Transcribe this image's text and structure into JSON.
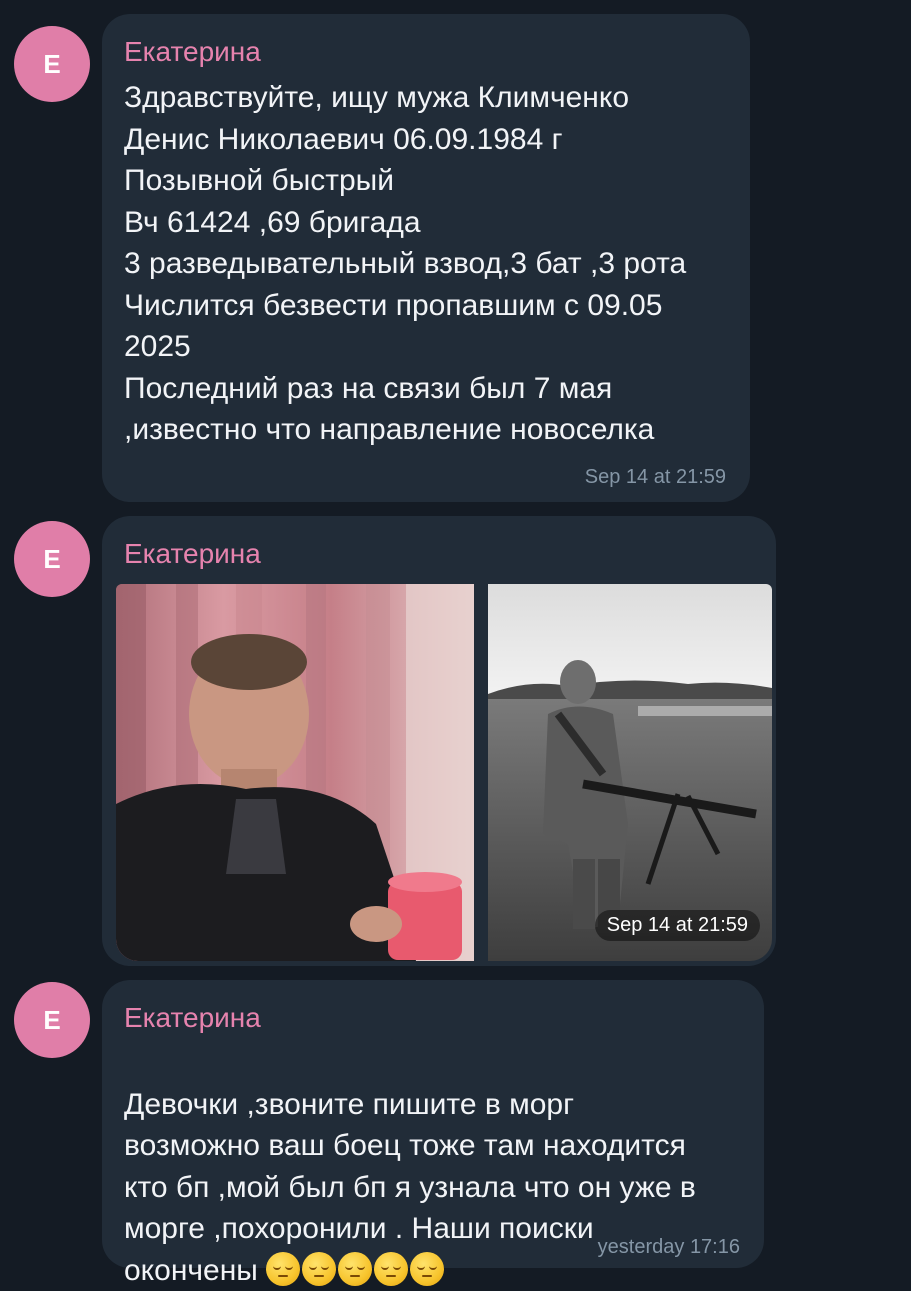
{
  "messages": [
    {
      "avatar_letter": "Е",
      "sender": "Екатерина",
      "text": "Здравствуйте, ищу мужа Климченко\nДенис Николаевич 06.09.1984 г\nПозывной быстрый\nВч 61424 ,69 бригада\n3 разведывательный взвод,3 бат ,3 рота\nЧислится безвести пропавшим с 09.05\n2025\nПоследний раз на связи был 7 мая\n,известно что направление новоселка",
      "time": "Sep 14 at 21:59"
    },
    {
      "avatar_letter": "Е",
      "sender": "Екатерина",
      "time": "Sep 14 at 21:59",
      "photos": [
        "photo-man-with-cup",
        "photo-soldier-with-machine-gun"
      ]
    },
    {
      "avatar_letter": "Е",
      "sender": "Екатерина",
      "text": "Девочки ,звоните пишите в морг\nвозможно ваш боец тоже там находится\nкто бп ,мой был бп я узнала что он уже в\nморге ,похоронили . Наши поиски\nокончены",
      "emojis": [
        "pensive-face-emoji",
        "pensive-face-emoji",
        "pensive-face-emoji",
        "pensive-face-emoji",
        "pensive-face-emoji"
      ],
      "time": "yesterday 17:16"
    }
  ],
  "colors": {
    "background": "#141b24",
    "bubble": "#212c38",
    "sender_name": "#e683ae",
    "avatar": "#e07ea8",
    "message_text": "#f2f4f7",
    "timestamp": "#8596a6"
  }
}
